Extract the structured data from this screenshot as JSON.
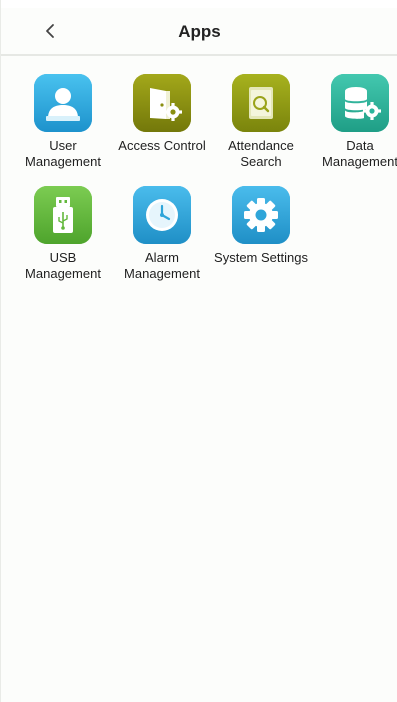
{
  "header": {
    "title": "Apps"
  },
  "apps": [
    {
      "label": "User\nManagement",
      "icon": "user-management-icon",
      "color": "#2aa7dd"
    },
    {
      "label": "Access Control",
      "icon": "access-control-icon",
      "color": "#8a8f10"
    },
    {
      "label": "Attendance\nSearch",
      "icon": "attendance-search-icon",
      "color": "#8f9a12"
    },
    {
      "label": "Data\nManagement",
      "icon": "data-management-icon",
      "color": "#2bb59c"
    },
    {
      "label": "USB\nManagement",
      "icon": "usb-management-icon",
      "color": "#63b83c"
    },
    {
      "label": "Alarm\nManagement",
      "icon": "alarm-management-icon",
      "color": "#2fa5d9"
    },
    {
      "label": "System Settings",
      "icon": "system-settings-icon",
      "color": "#2fa5d9"
    }
  ]
}
